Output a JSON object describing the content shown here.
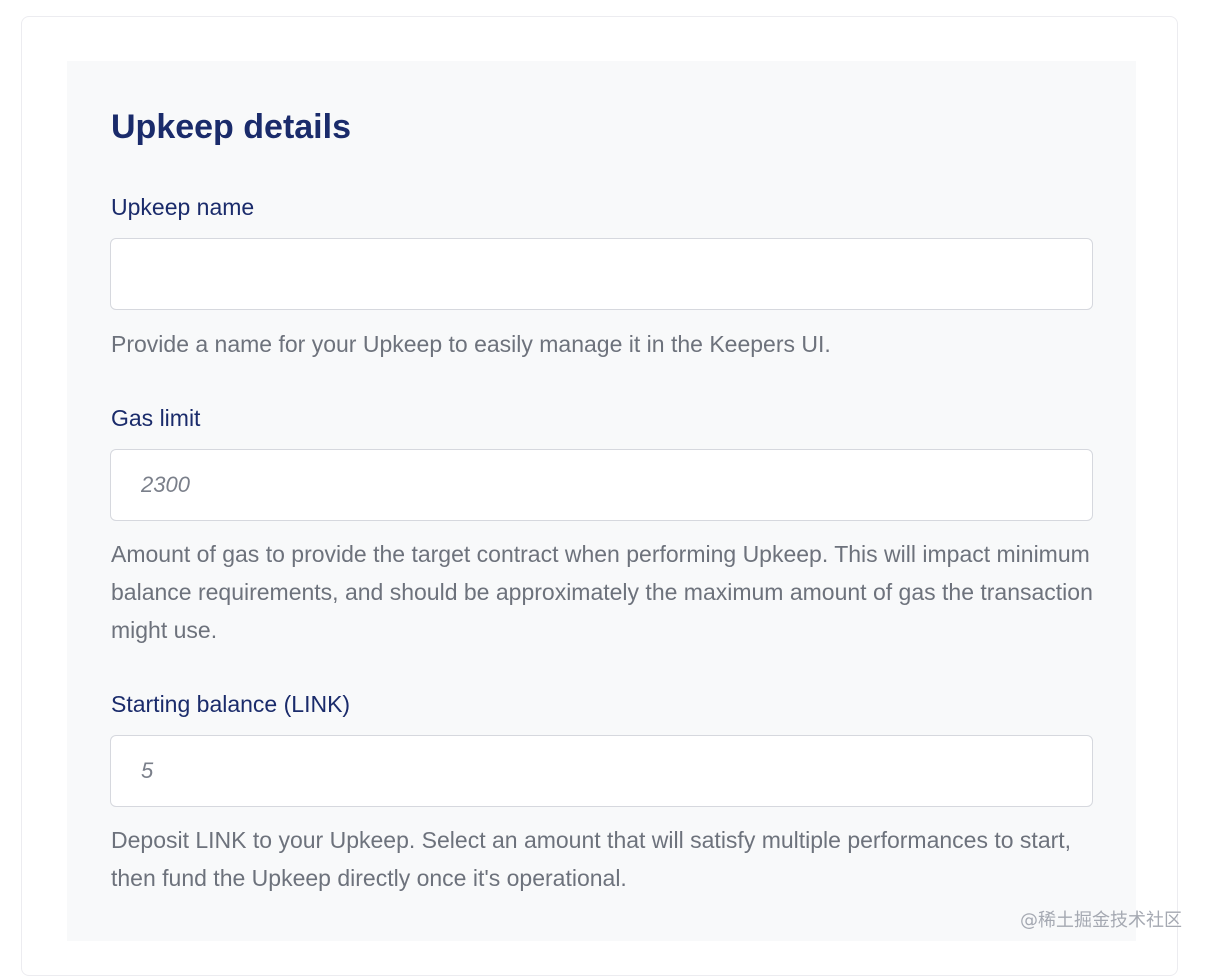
{
  "section": {
    "title": "Upkeep details"
  },
  "fields": {
    "upkeep_name": {
      "label": "Upkeep name",
      "value": "",
      "placeholder": "",
      "help": "Provide a name for your Upkeep to easily manage it in the Keepers UI."
    },
    "gas_limit": {
      "label": "Gas limit",
      "value": "",
      "placeholder": "2300",
      "help": "Amount of gas to provide the target contract when performing Upkeep. This will impact minimum balance requirements, and should be approximately the maximum amount of gas the transaction might use."
    },
    "starting_balance": {
      "label": "Starting balance (LINK)",
      "value": "",
      "placeholder": "5",
      "help": "Deposit LINK to your Upkeep. Select an amount that will satisfy multiple performances to start, then fund the Upkeep directly once it's operational."
    }
  },
  "watermark": "@稀土掘金技术社区"
}
